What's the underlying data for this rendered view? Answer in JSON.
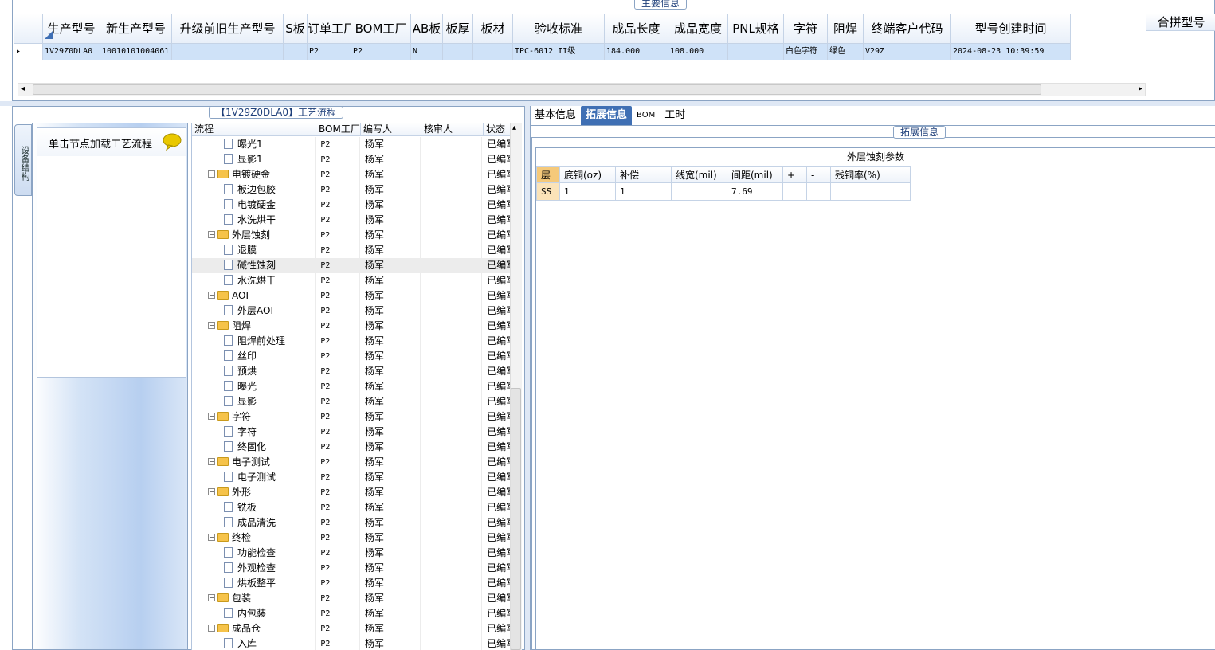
{
  "main_info": {
    "title": "主要信息",
    "columns": [
      "生产型号",
      "新生产型号",
      "升级前旧生产型号",
      "S板",
      "订单工厂",
      "BOM工厂",
      "AB板",
      "板厚",
      "板材",
      "验收标准",
      "成品长度",
      "成品宽度",
      "PNL规格",
      "字符",
      "阻焊",
      "终端客户代码",
      "型号创建时间"
    ],
    "row": [
      "1V29Z0DLA0",
      "10010101004061",
      "",
      "",
      "P2",
      "P2",
      "N",
      "",
      "",
      "IPC-6012 II级",
      "184.000",
      "108.000",
      "",
      "白色字符",
      "绿色",
      "V29Z",
      "2024-08-23 10:39:59"
    ],
    "merge_column": "合拼型号"
  },
  "process": {
    "title": "【1V29Z0DLA0】工艺流程",
    "side_tab": "设备结构",
    "hint": "单击节点加载工艺流程",
    "columns": [
      "流程",
      "BOM工厂",
      "编写人",
      "核审人",
      "状态"
    ],
    "rows": [
      {
        "type": "leaf",
        "name": "曝光1",
        "bom": "P2",
        "writer": "杨军",
        "reviewer": "",
        "status": "已编写"
      },
      {
        "type": "leaf",
        "name": "显影1",
        "bom": "P2",
        "writer": "杨军",
        "reviewer": "",
        "status": "已编写"
      },
      {
        "type": "folder",
        "name": "电镀硬金",
        "bom": "P2",
        "writer": "杨军",
        "reviewer": "",
        "status": "已编写"
      },
      {
        "type": "leaf",
        "name": "板边包胶",
        "bom": "P2",
        "writer": "杨军",
        "reviewer": "",
        "status": "已编写"
      },
      {
        "type": "leaf",
        "name": "电镀硬金",
        "bom": "P2",
        "writer": "杨军",
        "reviewer": "",
        "status": "已编写"
      },
      {
        "type": "leaf",
        "name": "水洗烘干",
        "bom": "P2",
        "writer": "杨军",
        "reviewer": "",
        "status": "已编写"
      },
      {
        "type": "folder",
        "name": "外层蚀刻",
        "bom": "P2",
        "writer": "杨军",
        "reviewer": "",
        "status": "已编写"
      },
      {
        "type": "leaf",
        "name": "退膜",
        "bom": "P2",
        "writer": "杨军",
        "reviewer": "",
        "status": "已编写"
      },
      {
        "type": "leaf",
        "name": "碱性蚀刻",
        "bom": "P2",
        "writer": "杨军",
        "reviewer": "",
        "status": "已编写",
        "selected": true
      },
      {
        "type": "leaf",
        "name": "水洗烘干",
        "bom": "P2",
        "writer": "杨军",
        "reviewer": "",
        "status": "已编写"
      },
      {
        "type": "folder",
        "name": "AOI",
        "bom": "P2",
        "writer": "杨军",
        "reviewer": "",
        "status": "已编写"
      },
      {
        "type": "leaf",
        "name": "外层AOI",
        "bom": "P2",
        "writer": "杨军",
        "reviewer": "",
        "status": "已编写"
      },
      {
        "type": "folder",
        "name": "阻焊",
        "bom": "P2",
        "writer": "杨军",
        "reviewer": "",
        "status": "已编写"
      },
      {
        "type": "leaf",
        "name": "阻焊前处理",
        "bom": "P2",
        "writer": "杨军",
        "reviewer": "",
        "status": "已编写"
      },
      {
        "type": "leaf",
        "name": "丝印",
        "bom": "P2",
        "writer": "杨军",
        "reviewer": "",
        "status": "已编写"
      },
      {
        "type": "leaf",
        "name": "预烘",
        "bom": "P2",
        "writer": "杨军",
        "reviewer": "",
        "status": "已编写"
      },
      {
        "type": "leaf",
        "name": "曝光",
        "bom": "P2",
        "writer": "杨军",
        "reviewer": "",
        "status": "已编写"
      },
      {
        "type": "leaf",
        "name": "显影",
        "bom": "P2",
        "writer": "杨军",
        "reviewer": "",
        "status": "已编写"
      },
      {
        "type": "folder",
        "name": "字符",
        "bom": "P2",
        "writer": "杨军",
        "reviewer": "",
        "status": "已编写"
      },
      {
        "type": "leaf",
        "name": "字符",
        "bom": "P2",
        "writer": "杨军",
        "reviewer": "",
        "status": "已编写"
      },
      {
        "type": "leaf",
        "name": "终固化",
        "bom": "P2",
        "writer": "杨军",
        "reviewer": "",
        "status": "已编写"
      },
      {
        "type": "folder",
        "name": "电子测试",
        "bom": "P2",
        "writer": "杨军",
        "reviewer": "",
        "status": "已编写"
      },
      {
        "type": "leaf",
        "name": "电子测试",
        "bom": "P2",
        "writer": "杨军",
        "reviewer": "",
        "status": "已编写"
      },
      {
        "type": "folder",
        "name": "外形",
        "bom": "P2",
        "writer": "杨军",
        "reviewer": "",
        "status": "已编写"
      },
      {
        "type": "leaf",
        "name": "铣板",
        "bom": "P2",
        "writer": "杨军",
        "reviewer": "",
        "status": "已编写"
      },
      {
        "type": "leaf",
        "name": "成品清洗",
        "bom": "P2",
        "writer": "杨军",
        "reviewer": "",
        "status": "已编写"
      },
      {
        "type": "folder",
        "name": "终检",
        "bom": "P2",
        "writer": "杨军",
        "reviewer": "",
        "status": "已编写"
      },
      {
        "type": "leaf",
        "name": "功能检查",
        "bom": "P2",
        "writer": "杨军",
        "reviewer": "",
        "status": "已编写"
      },
      {
        "type": "leaf",
        "name": "外观检查",
        "bom": "P2",
        "writer": "杨军",
        "reviewer": "",
        "status": "已编写"
      },
      {
        "type": "leaf",
        "name": "烘板整平",
        "bom": "P2",
        "writer": "杨军",
        "reviewer": "",
        "status": "已编写"
      },
      {
        "type": "folder",
        "name": "包装",
        "bom": "P2",
        "writer": "杨军",
        "reviewer": "",
        "status": "已编写"
      },
      {
        "type": "leaf",
        "name": "内包装",
        "bom": "P2",
        "writer": "杨军",
        "reviewer": "",
        "status": "已编写"
      },
      {
        "type": "folder",
        "name": "成品仓",
        "bom": "P2",
        "writer": "杨军",
        "reviewer": "",
        "status": "已编写"
      },
      {
        "type": "leaf",
        "name": "入库",
        "bom": "P2",
        "writer": "杨军",
        "reviewer": "",
        "status": "已编写"
      }
    ]
  },
  "tabs": [
    "基本信息",
    "拓展信息",
    "BOM",
    "工时"
  ],
  "active_tab": 1,
  "extended": {
    "title": "拓展信息",
    "section_title": "外层蚀刻参数",
    "columns": [
      "层",
      "底铜(oz)",
      "补偿",
      "线宽(mil)",
      "间距(mil)",
      "+",
      "-",
      "残铜率(%)"
    ],
    "row": [
      "SS",
      "1",
      "1",
      "",
      "7.69",
      "",
      "",
      ""
    ]
  },
  "colors": {
    "accent": "#3f6fb4",
    "border": "#8ba4c4",
    "row_selected": "#cfe2f8"
  }
}
